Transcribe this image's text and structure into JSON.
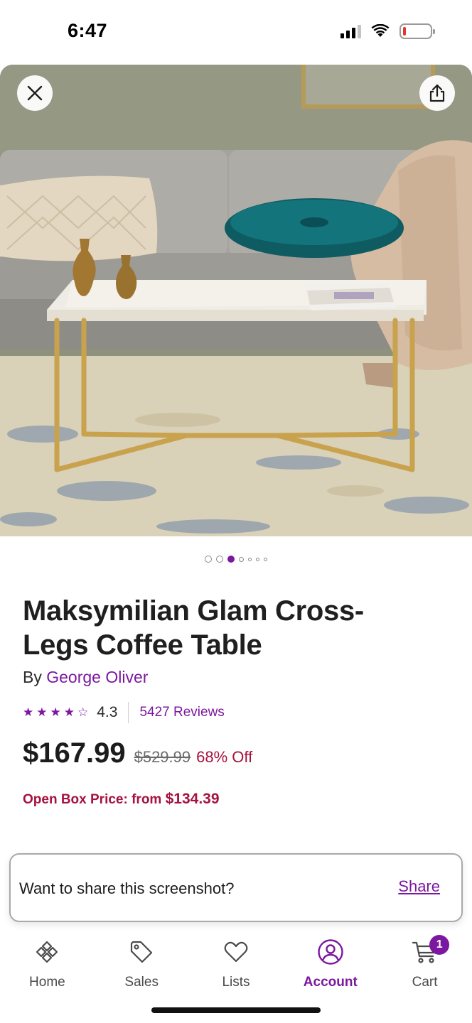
{
  "status_bar": {
    "time": "6:47"
  },
  "hero": {
    "close_icon": "close-icon",
    "share_icon": "share-icon",
    "carousel": {
      "total": 7,
      "active_index": 2
    }
  },
  "product": {
    "title": "Maksymilian Glam Cross-Legs Coffee Table",
    "brand_prefix": "By",
    "brand": "George Oliver",
    "rating": "4.3",
    "stars": 4.5,
    "reviews": "5427 Reviews",
    "price": "$167.99",
    "price_old": "$529.99",
    "discount": "68% Off",
    "open_box_label": "Open Box Price: from",
    "open_box_price": "$134.39"
  },
  "share_toast": {
    "text": "Want to share this screenshot?",
    "action": "Share"
  },
  "nav": {
    "items": [
      {
        "label": "Home",
        "icon": "home-icon"
      },
      {
        "label": "Sales",
        "icon": "tag-icon"
      },
      {
        "label": "Lists",
        "icon": "heart-icon"
      },
      {
        "label": "Account",
        "icon": "account-icon",
        "active": true
      },
      {
        "label": "Cart",
        "icon": "cart-icon",
        "badge": "1"
      }
    ]
  },
  "colors": {
    "accent": "#7b189f",
    "sale": "#a5123f"
  }
}
